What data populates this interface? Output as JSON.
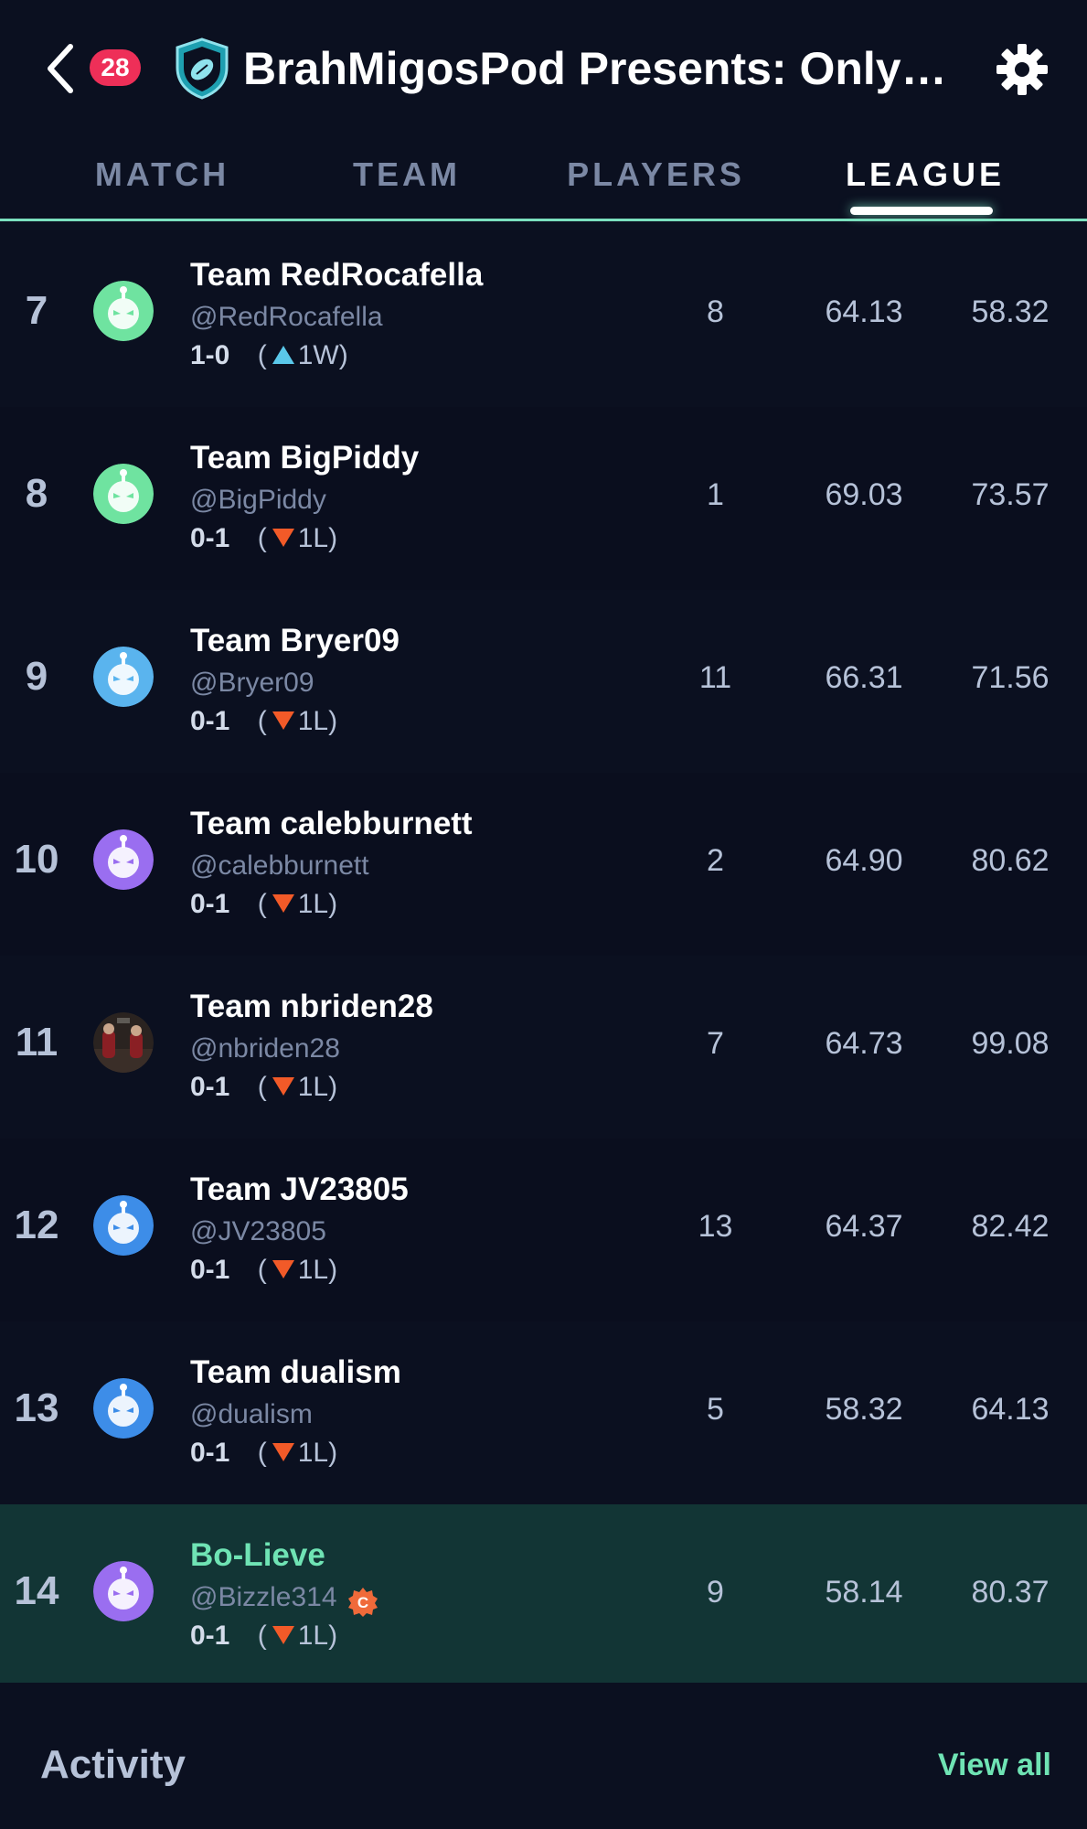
{
  "header": {
    "title": "BrahMigosPod Presents: OnlyB…",
    "notification_count": "28"
  },
  "tabs": [
    {
      "label": "MATCH",
      "active": false
    },
    {
      "label": "TEAM",
      "active": false
    },
    {
      "label": "PLAYERS",
      "active": false
    },
    {
      "label": "LEAGUE",
      "active": true
    }
  ],
  "standings": [
    {
      "rank": "7",
      "team": "Team RedRocafella",
      "handle": "@RedRocafella",
      "record": "1-0",
      "streak_dir": "up",
      "streak": "1W",
      "col1": "8",
      "col2": "64.13",
      "col3": "58.32",
      "avatar_color": "#6fe3a0"
    },
    {
      "rank": "8",
      "team": "Team BigPiddy",
      "handle": "@BigPiddy",
      "record": "0-1",
      "streak_dir": "down",
      "streak": "1L",
      "col1": "1",
      "col2": "69.03",
      "col3": "73.57",
      "avatar_color": "#6fe3a0"
    },
    {
      "rank": "9",
      "team": "Team Bryer09",
      "handle": "@Bryer09",
      "record": "0-1",
      "streak_dir": "down",
      "streak": "1L",
      "col1": "11",
      "col2": "66.31",
      "col3": "71.56",
      "avatar_color": "#5ab4ee"
    },
    {
      "rank": "10",
      "team": "Team calebburnett",
      "handle": "@calebburnett",
      "record": "0-1",
      "streak_dir": "down",
      "streak": "1L",
      "col1": "2",
      "col2": "64.90",
      "col3": "80.62",
      "avatar_color": "#9a6ef0"
    },
    {
      "rank": "11",
      "team": "Team nbriden28",
      "handle": "@nbriden28",
      "record": "0-1",
      "streak_dir": "down",
      "streak": "1L",
      "col1": "7",
      "col2": "64.73",
      "col3": "99.08",
      "avatar_color": "photo"
    },
    {
      "rank": "12",
      "team": "Team JV23805",
      "handle": "@JV23805",
      "record": "0-1",
      "streak_dir": "down",
      "streak": "1L",
      "col1": "13",
      "col2": "64.37",
      "col3": "82.42",
      "avatar_color": "#3d8de8"
    },
    {
      "rank": "13",
      "team": "Team dualism",
      "handle": "@dualism",
      "record": "0-1",
      "streak_dir": "down",
      "streak": "1L",
      "col1": "5",
      "col2": "58.32",
      "col3": "64.13",
      "avatar_color": "#3d8de8"
    },
    {
      "rank": "14",
      "team": "Bo-Lieve",
      "handle": "@Bizzle314",
      "record": "0-1",
      "streak_dir": "down",
      "streak": "1L",
      "col1": "9",
      "col2": "58.14",
      "col3": "80.37",
      "avatar_color": "#9a6ef0",
      "current_user": true,
      "commissioner_badge": "C"
    }
  ],
  "activity": {
    "title": "Activity",
    "view_all": "View all"
  },
  "colors": {
    "background": "#0b1020",
    "accent": "#6fe3b4",
    "highlight_row": "#123535",
    "badge": "#ee2f58",
    "win": "#5ac8ea",
    "loss": "#f25a28"
  }
}
